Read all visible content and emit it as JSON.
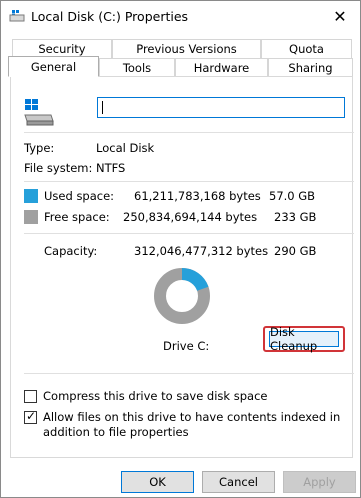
{
  "window": {
    "title": "Local Disk (C:) Properties",
    "close_glyph": "✕"
  },
  "tabs_top": [
    "Security",
    "Previous Versions",
    "Quota"
  ],
  "tabs_bottom": [
    "General",
    "Tools",
    "Hardware",
    "Sharing"
  ],
  "active_tab": "General",
  "drive": {
    "name_value": ""
  },
  "info": {
    "type_label": "Type:",
    "type_value": "Local Disk",
    "fs_label": "File system:",
    "fs_value": "NTFS"
  },
  "space": {
    "used_label": "Used space:",
    "used_bytes": "61,211,783,168 bytes",
    "used_gb": "57.0 GB",
    "free_label": "Free space:",
    "free_bytes": "250,834,694,144 bytes",
    "free_gb": "233 GB",
    "cap_label": "Capacity:",
    "cap_bytes": "312,046,477,312 bytes",
    "cap_gb": "290 GB",
    "used_fraction": 0.196
  },
  "colors": {
    "used": "#26a0da",
    "free": "#a0a0a0",
    "highlight": "#d13438"
  },
  "drive_label": "Drive C:",
  "cleanup_label": "Disk Cleanup",
  "options": {
    "compress_label": "Compress this drive to save disk space",
    "compress_checked": false,
    "index_label": "Allow files on this drive to have contents indexed in addition to file properties",
    "index_checked": true
  },
  "buttons": {
    "ok": "OK",
    "cancel": "Cancel",
    "apply": "Apply"
  }
}
